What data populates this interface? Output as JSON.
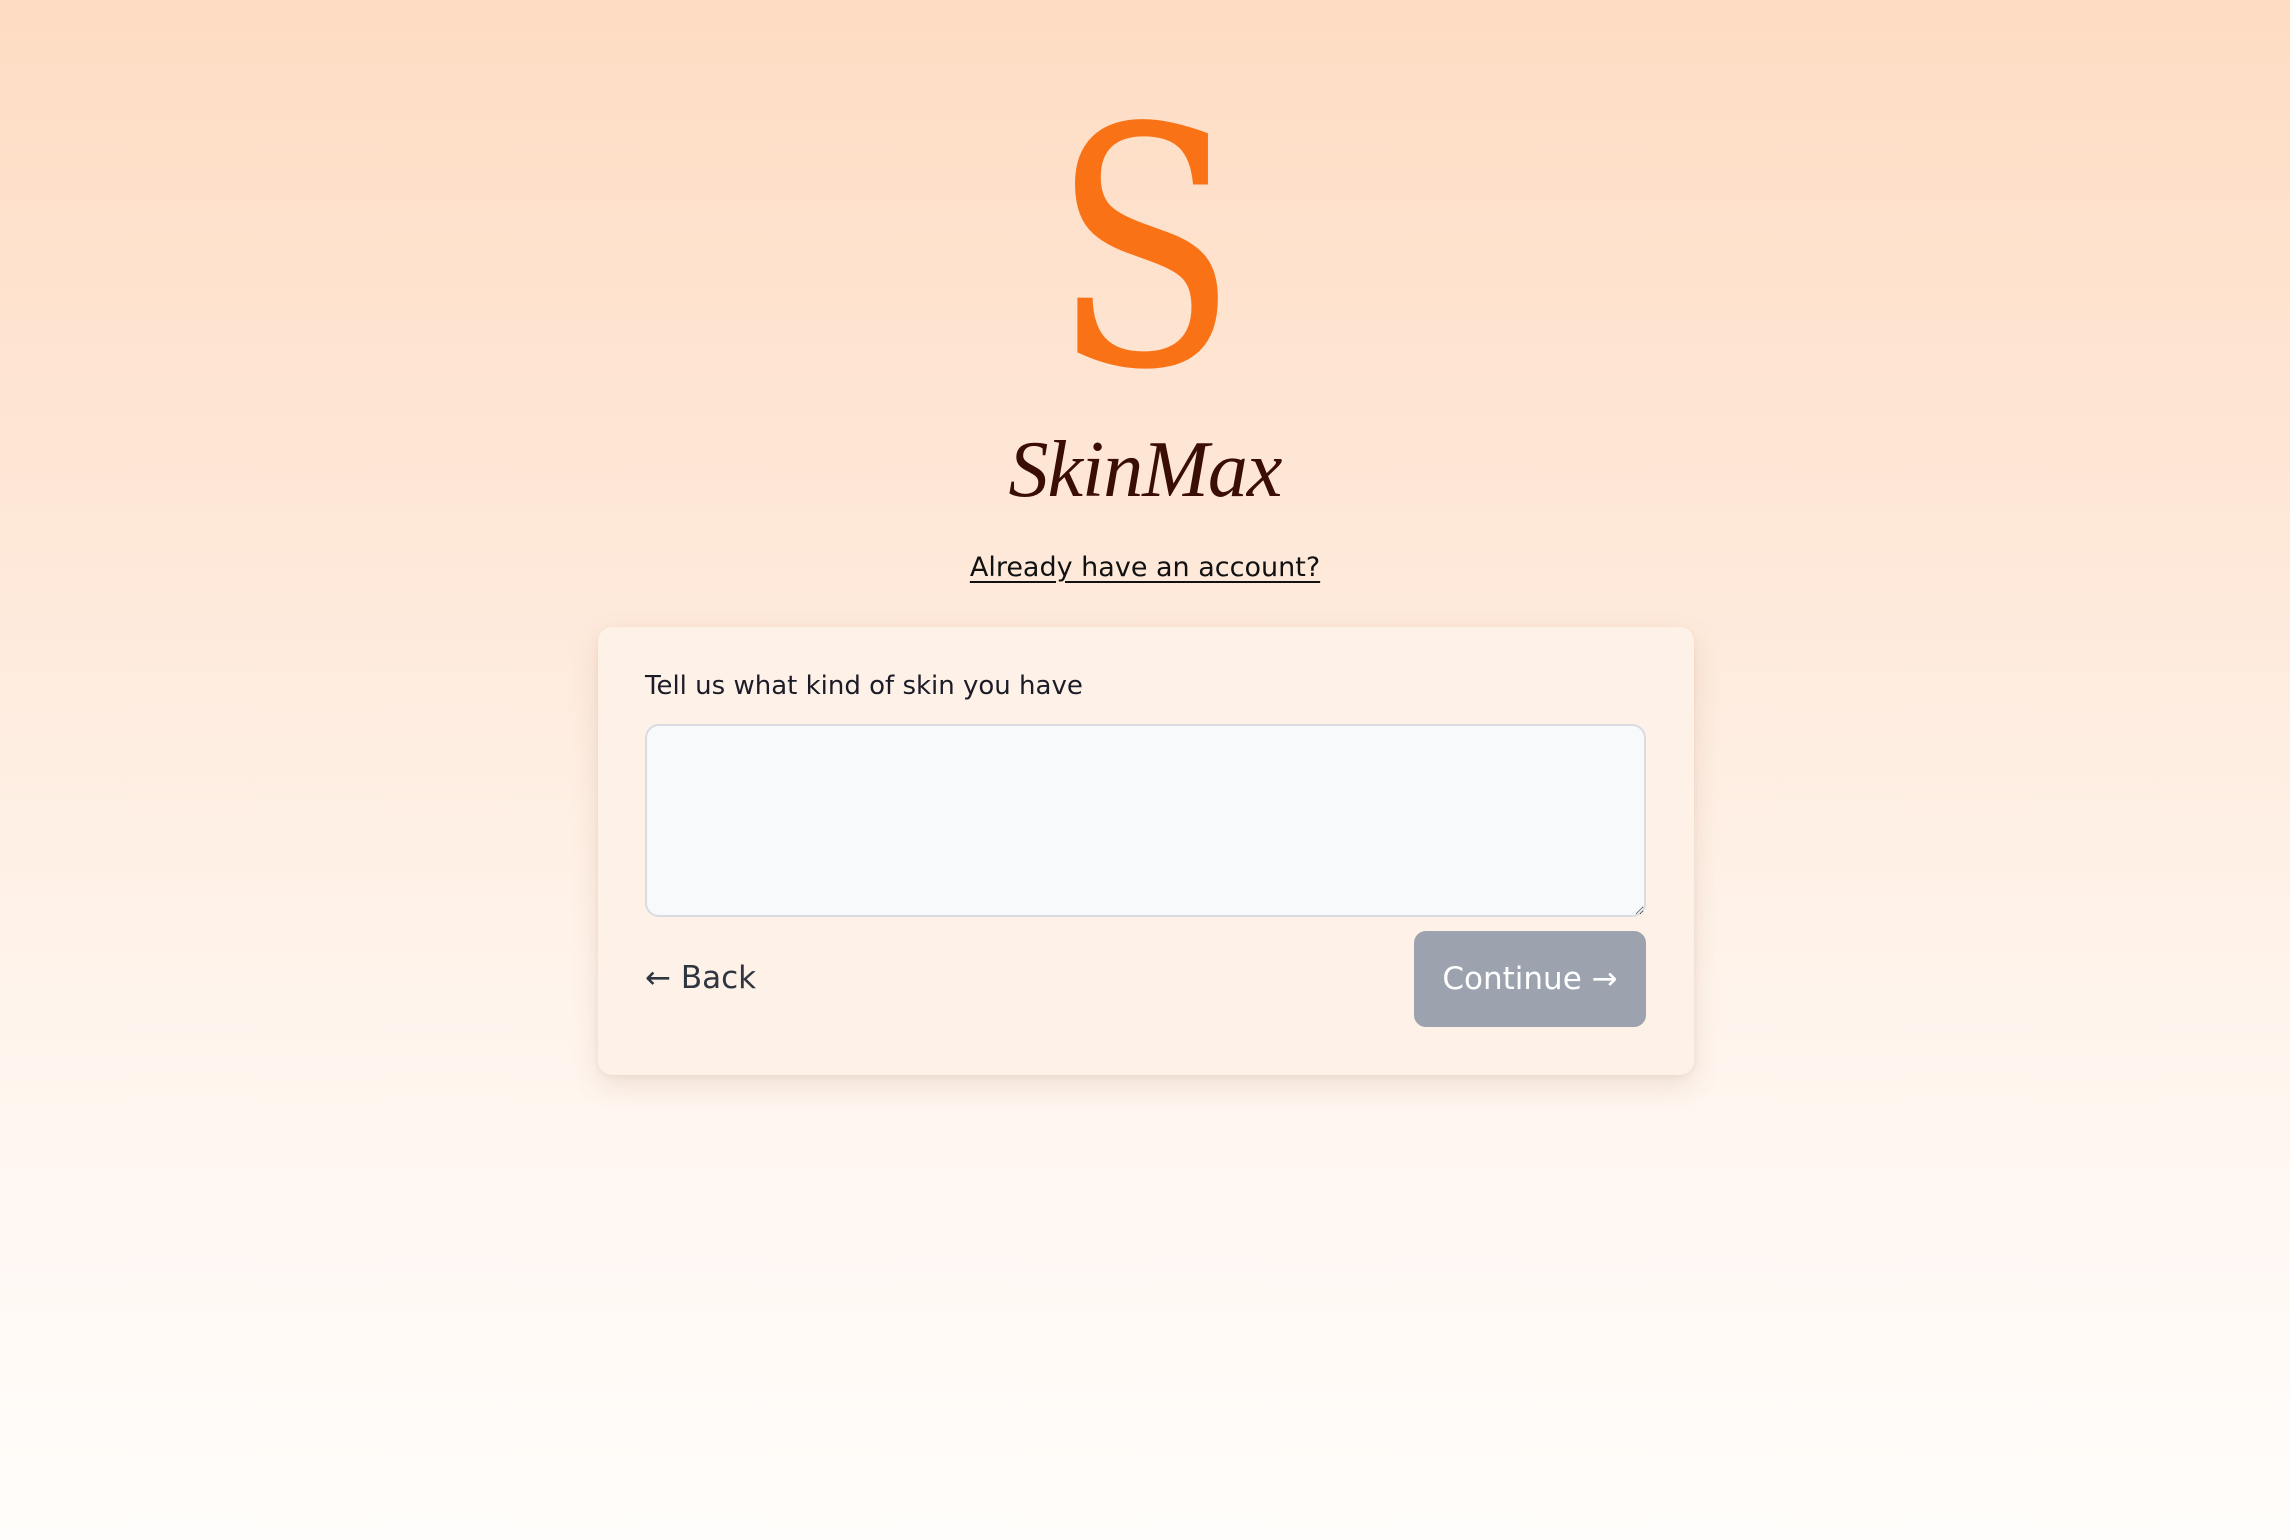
{
  "logo": {
    "mark": "S",
    "brand_name": "SkinMax"
  },
  "login_link": {
    "label": "Already have an account?"
  },
  "form": {
    "question_label": "Tell us what kind of skin you have",
    "skin_input_value": "",
    "back_label": "← Back",
    "continue_label": "Continue →",
    "continue_disabled": true
  },
  "colors": {
    "brand_orange": "#f97316",
    "brand_text": "#3a0d05",
    "button_disabled": "#9ca2ae"
  }
}
